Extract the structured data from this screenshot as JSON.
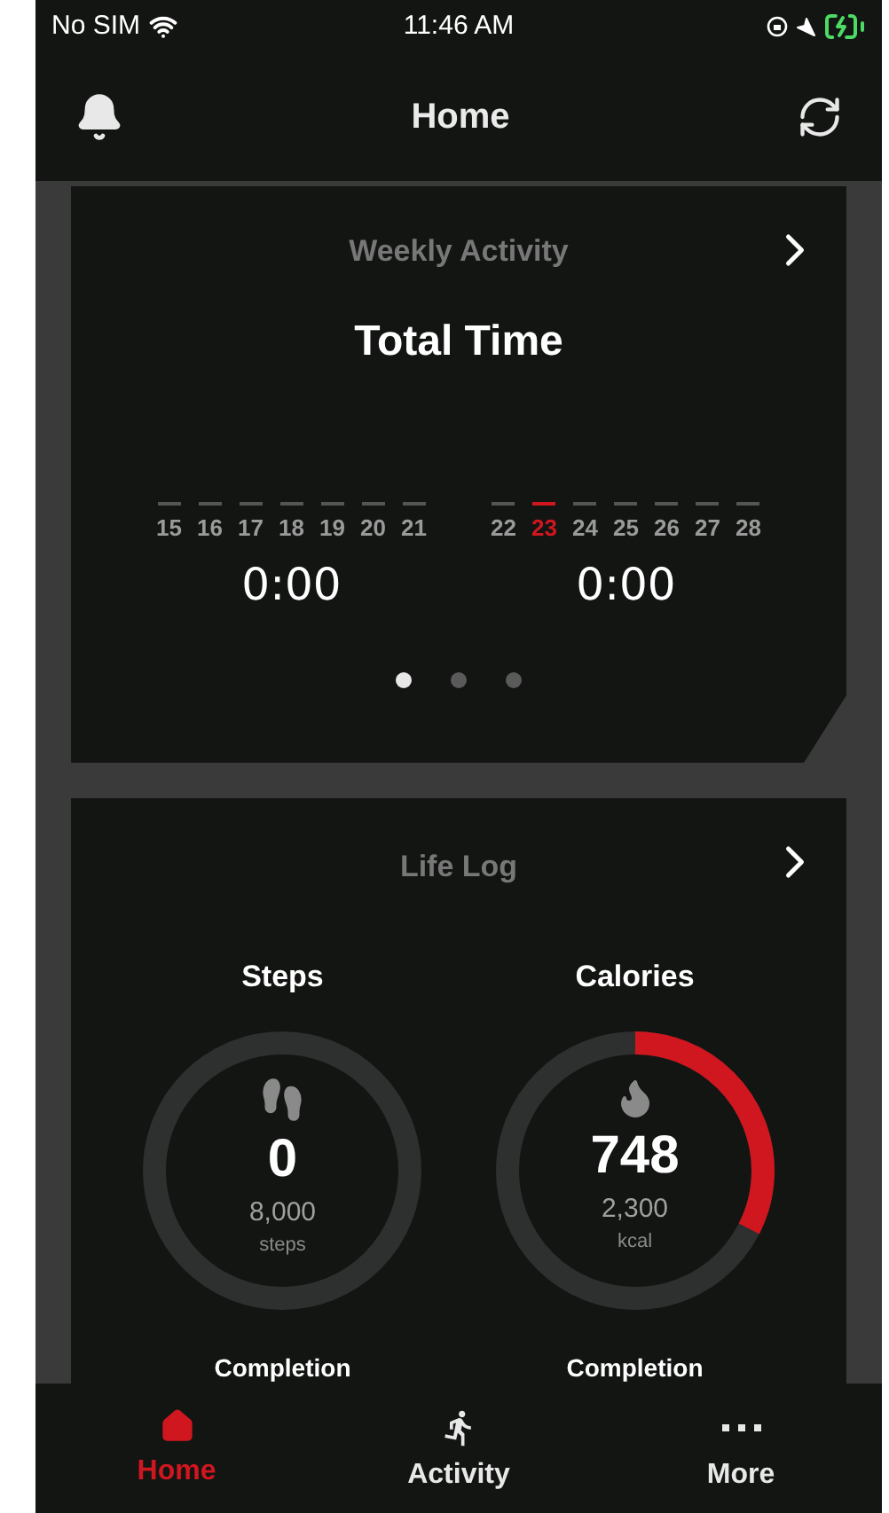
{
  "status_bar": {
    "carrier": "No SIM",
    "time": "11:46 AM"
  },
  "header": {
    "title": "Home"
  },
  "weekly_activity": {
    "title": "Weekly Activity",
    "subtitle": "Total Time",
    "weeks": [
      {
        "days": [
          {
            "label": "15",
            "selected": false
          },
          {
            "label": "16",
            "selected": false
          },
          {
            "label": "17",
            "selected": false
          },
          {
            "label": "18",
            "selected": false
          },
          {
            "label": "19",
            "selected": false
          },
          {
            "label": "20",
            "selected": false
          },
          {
            "label": "21",
            "selected": false
          }
        ],
        "total": "0:00"
      },
      {
        "days": [
          {
            "label": "22",
            "selected": false
          },
          {
            "label": "23",
            "selected": true
          },
          {
            "label": "24",
            "selected": false
          },
          {
            "label": "25",
            "selected": false
          },
          {
            "label": "26",
            "selected": false
          },
          {
            "label": "27",
            "selected": false
          },
          {
            "label": "28",
            "selected": false
          }
        ],
        "total": "0:00"
      }
    ],
    "pages": [
      {
        "selected": true
      },
      {
        "selected": false
      },
      {
        "selected": false
      }
    ]
  },
  "life_log": {
    "title": "Life Log",
    "metrics": [
      {
        "kind": "steps",
        "label": "Steps",
        "value": "0",
        "goal": "8,000",
        "unit": "steps",
        "level": 0,
        "completion_label": "Completion"
      },
      {
        "kind": "calories",
        "label": "Calories",
        "value": "748",
        "goal": "2,300",
        "unit": "kcal",
        "level": 0.325,
        "completion_label": "Completion"
      }
    ]
  },
  "tab_bar": [
    {
      "kind": "home",
      "label": "Home",
      "selected": true
    },
    {
      "kind": "activity",
      "label": "Activity",
      "selected": false
    },
    {
      "kind": "more",
      "label": "More",
      "selected": false
    }
  ]
}
